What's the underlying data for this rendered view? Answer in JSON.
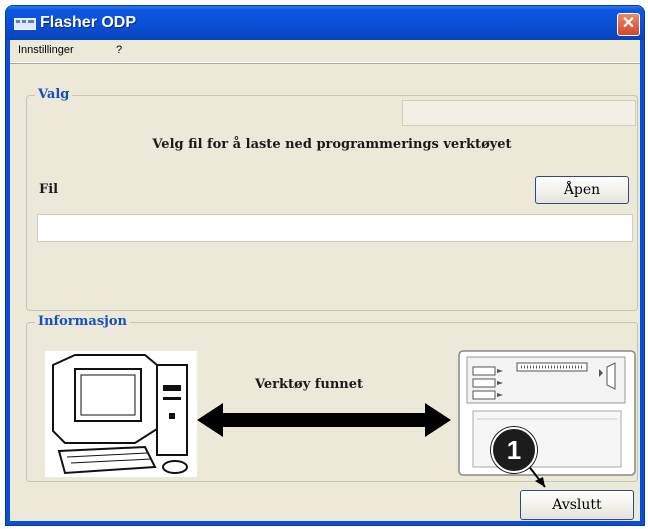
{
  "window": {
    "title": "Flasher ODP"
  },
  "menu": {
    "items": [
      "Innstillinger",
      "?"
    ]
  },
  "valg": {
    "group_title": "Valg",
    "instruction": "Velg fil for å laste ned programmerings verktøyet",
    "file_label": "Fil",
    "open_button": "Åpen",
    "file_value": "",
    "status_value": ""
  },
  "info": {
    "group_title": "Informasjon",
    "status_text": "Verktøy funnet",
    "callout_number": "1"
  },
  "footer": {
    "exit_button": "Avslutt"
  },
  "colors": {
    "titlebar": "#0a4fd6",
    "dialog_bg": "#ece9d8",
    "group_title": "#1a4fbf"
  }
}
